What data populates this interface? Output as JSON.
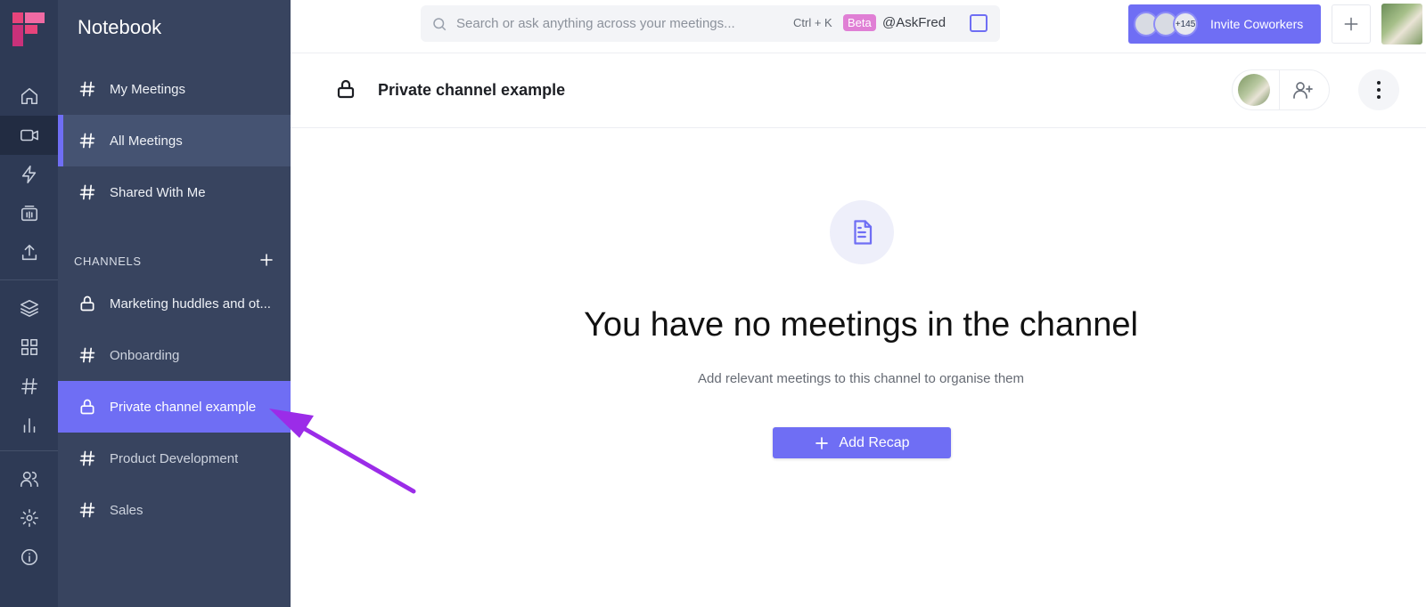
{
  "app": {
    "name": "Notebook"
  },
  "rail": {
    "icons": [
      "home-icon",
      "video-icon",
      "lightning-icon",
      "soundbite-icon",
      "upload-icon",
      "layers-icon",
      "apps-grid-icon",
      "hash-icon",
      "bar-chart-icon",
      "users-icon",
      "settings-icon",
      "info-icon"
    ],
    "active": "video-icon"
  },
  "sidebar": {
    "title": "Notebook",
    "items": [
      {
        "label": "My Meetings",
        "icon": "hash-icon"
      },
      {
        "label": "All Meetings",
        "icon": "hash-icon"
      },
      {
        "label": "Shared With Me",
        "icon": "hash-icon"
      }
    ],
    "channels_header": "CHANNELS",
    "channels": [
      {
        "label": "Marketing huddles and ot...",
        "icon": "lock-icon"
      },
      {
        "label": "Onboarding",
        "icon": "hash-icon"
      },
      {
        "label": "Private channel example",
        "icon": "lock-icon",
        "selected": true
      },
      {
        "label": "Product Development",
        "icon": "hash-icon"
      },
      {
        "label": "Sales",
        "icon": "hash-icon"
      }
    ]
  },
  "topbar": {
    "search_placeholder": "Search or ask anything across your meetings...",
    "shortcut": "Ctrl + K",
    "beta_badge": "Beta",
    "ask_fred": "@AskFred",
    "invite_count": "+145",
    "invite_label": "Invite Coworkers"
  },
  "channel": {
    "title": "Private channel example"
  },
  "empty_state": {
    "title": "You have no meetings in the channel",
    "subtitle": "Add relevant meetings to this channel to organise them",
    "button_label": "Add Recap"
  },
  "colors": {
    "accent": "#6f6ef4",
    "rail_bg": "#2e3a55",
    "sidebar_bg": "#38445f",
    "annotation_arrow": "#9b2ce8"
  }
}
